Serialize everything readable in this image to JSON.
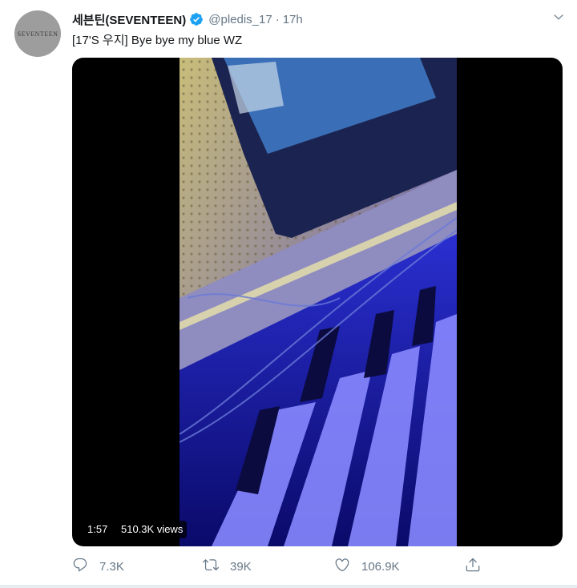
{
  "tweet": {
    "avatar_text": "SEVENTEEN",
    "display_name": "세븐틴(SEVENTEEN)",
    "handle": "@pledis_17",
    "separator": "·",
    "time": "17h",
    "text": "[17'S 우지] Bye bye my blue WZ"
  },
  "video": {
    "duration": "1:57",
    "views": "510.3K views"
  },
  "actions": {
    "reply_count": "7.3K",
    "retweet_count": "39K",
    "like_count": "106.9K"
  },
  "icons": {
    "verified": "verified-badge-icon",
    "caret": "chevron-down-icon",
    "reply": "reply-icon",
    "retweet": "retweet-icon",
    "like": "heart-icon",
    "share": "share-icon"
  },
  "colors": {
    "verified_blue": "#1da1f2",
    "secondary_text": "#657786",
    "primary_text": "#14171a"
  }
}
